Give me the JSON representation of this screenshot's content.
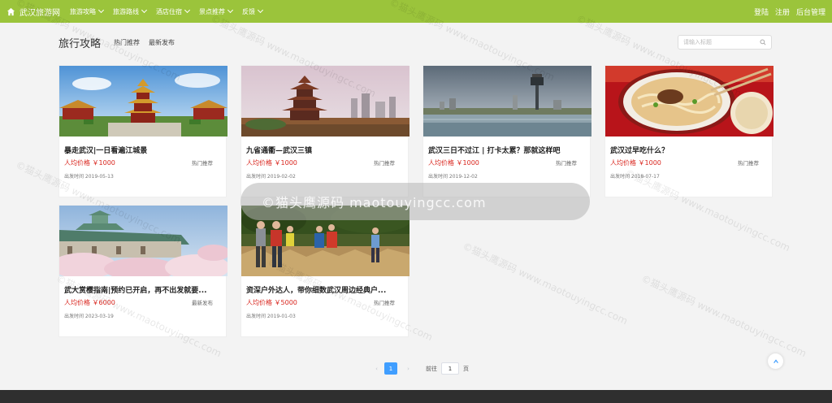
{
  "nav": {
    "brand": "武汉旅游网",
    "items": [
      {
        "label": "旅游攻略"
      },
      {
        "label": "旅游路线"
      },
      {
        "label": "酒店住宿"
      },
      {
        "label": "景点推荐"
      },
      {
        "label": "反馈"
      }
    ],
    "right": {
      "login": "登陆",
      "register": "注册",
      "admin": "后台管理"
    }
  },
  "header": {
    "title": "旅行攻略",
    "tabs": [
      {
        "label": "热门推荐"
      },
      {
        "label": "最新发布"
      }
    ],
    "search_placeholder": "请输入标题"
  },
  "cards": [
    {
      "title": "暴走武汉|一日看遍江城景",
      "price": "人均价格 ￥1000",
      "tag": "热门推荐",
      "date": "出发时间 2019-05-13",
      "image": "yellow-crane-tower"
    },
    {
      "title": "九省通衢—武汉三镇",
      "price": "人均价格 ￥1000",
      "tag": "热门推荐",
      "date": "出发时间 2019-02-02",
      "image": "tower-city-view"
    },
    {
      "title": "武汉三日不过江 | 打卡太累？那就这样吧",
      "price": "人均价格 ￥1000",
      "tag": "热门推荐",
      "date": "出发时间 2019-12-02",
      "image": "riverside-city"
    },
    {
      "title": "武汉过早吃什么？",
      "price": "人均价格 ￥1000",
      "tag": "热门推荐",
      "date": "出发时间 2018-07-17",
      "image": "noodle-bowl"
    },
    {
      "title": "武大赏樱指南|预约已开启，再不出发就要...",
      "price": "人均价格 ￥6000",
      "tag": "最新发布",
      "date": "出发时间 2023-03-19",
      "image": "cherry-blossom-campus"
    },
    {
      "title": "资深户外达人，带你细数武汉周边经典户...",
      "price": "人均价格 ￥5000",
      "tag": "热门推荐",
      "date": "出发时间 2019-01-03",
      "image": "hikers"
    }
  ],
  "pagination": {
    "current": "1",
    "goto_label": "前往",
    "goto_value": "1",
    "page_unit": "页"
  },
  "watermark": {
    "text": "©猫头鹰源码 www.maotouyingcc.com",
    "banner": "©猫头鹰源码 maotouyingcc.com"
  },
  "colors": {
    "navbar": "#9bc43b",
    "price": "#d9251d",
    "active_page": "#409eff",
    "footer": "#2f2f2f"
  }
}
